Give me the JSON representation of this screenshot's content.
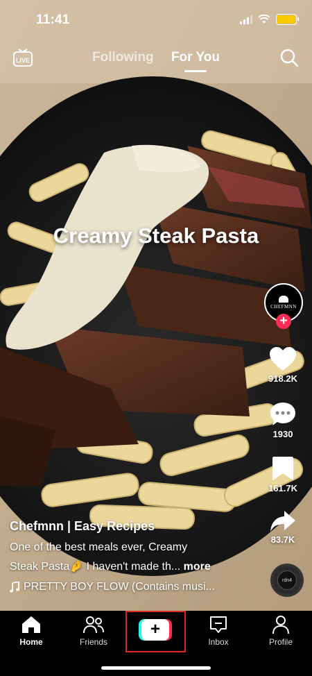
{
  "status_bar": {
    "time": "11:41"
  },
  "top_nav": {
    "live_label": "LIVE",
    "tabs": [
      {
        "label": "Following",
        "active": false
      },
      {
        "label": "For You",
        "active": true
      }
    ]
  },
  "video": {
    "overlay_title": "Creamy Steak Pasta",
    "creator_avatar_text": "CHEFMNN",
    "username": "Chefmnn | Easy Recipes",
    "description_line1": "One of the best meals ever, Creamy",
    "description_line2": "Steak Pasta🤌 I haven't made th...",
    "more_label": "more",
    "music": "PRETTY BOY FLOW (Contains musi...",
    "disc_text": "rdn4"
  },
  "actions": {
    "likes": "918.2K",
    "comments": "1930",
    "saves": "161.7K",
    "shares": "83.7K"
  },
  "bottom_nav": {
    "items": [
      {
        "label": "Home",
        "icon": "home-icon",
        "active": true
      },
      {
        "label": "Friends",
        "icon": "friends-icon",
        "active": false
      },
      {
        "label": "",
        "icon": "create-plus-icon",
        "active": false
      },
      {
        "label": "Inbox",
        "icon": "inbox-icon",
        "active": false
      },
      {
        "label": "Profile",
        "icon": "profile-icon",
        "active": false
      }
    ]
  },
  "colors": {
    "accent": "#fe2c55",
    "accent_cyan": "#25f4ee",
    "battery": "#f7c900",
    "highlight_border": "#e0271f"
  }
}
